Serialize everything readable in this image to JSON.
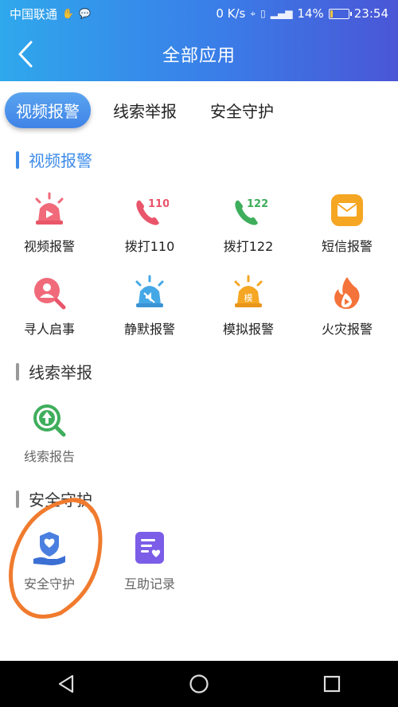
{
  "status_bar": {
    "carrier": "中国联通",
    "speed": "0 K/s",
    "battery": "14%",
    "time": "23:54",
    "battery_level": 0.14
  },
  "header": {
    "title": "全部应用"
  },
  "tabs": [
    {
      "label": "视频报警",
      "active": true
    },
    {
      "label": "线索举报",
      "active": false
    },
    {
      "label": "安全守护",
      "active": false
    }
  ],
  "sections": [
    {
      "title": "视频报警",
      "bar_color": "#3c8be9",
      "items": [
        {
          "label": "视频报警",
          "icon": "siren-video-icon"
        },
        {
          "label": "拨打110",
          "icon": "phone-110-icon"
        },
        {
          "label": "拨打122",
          "icon": "phone-122-icon"
        },
        {
          "label": "短信报警",
          "icon": "sms-envelope-icon"
        },
        {
          "label": "寻人启事",
          "icon": "person-search-icon"
        },
        {
          "label": "静默报警",
          "icon": "silent-siren-icon"
        },
        {
          "label": "模拟报警",
          "icon": "simulated-siren-icon"
        },
        {
          "label": "火灾报警",
          "icon": "fire-icon"
        }
      ]
    },
    {
      "title": "线索举报",
      "bar_color": "#999999",
      "items": [
        {
          "label": "线索报告",
          "icon": "clue-search-icon"
        }
      ]
    },
    {
      "title": "安全守护",
      "bar_color": "#999999",
      "items": [
        {
          "label": "安全守护",
          "icon": "shield-hand-icon"
        },
        {
          "label": "互助记录",
          "icon": "mutual-aid-record-icon"
        }
      ]
    }
  ],
  "colors": {
    "header_gradient_start": "#2fa8ec",
    "header_gradient_end": "#4a56d6",
    "active_tab": "#3f83e6",
    "annotation_circle": "#f07b2e"
  }
}
